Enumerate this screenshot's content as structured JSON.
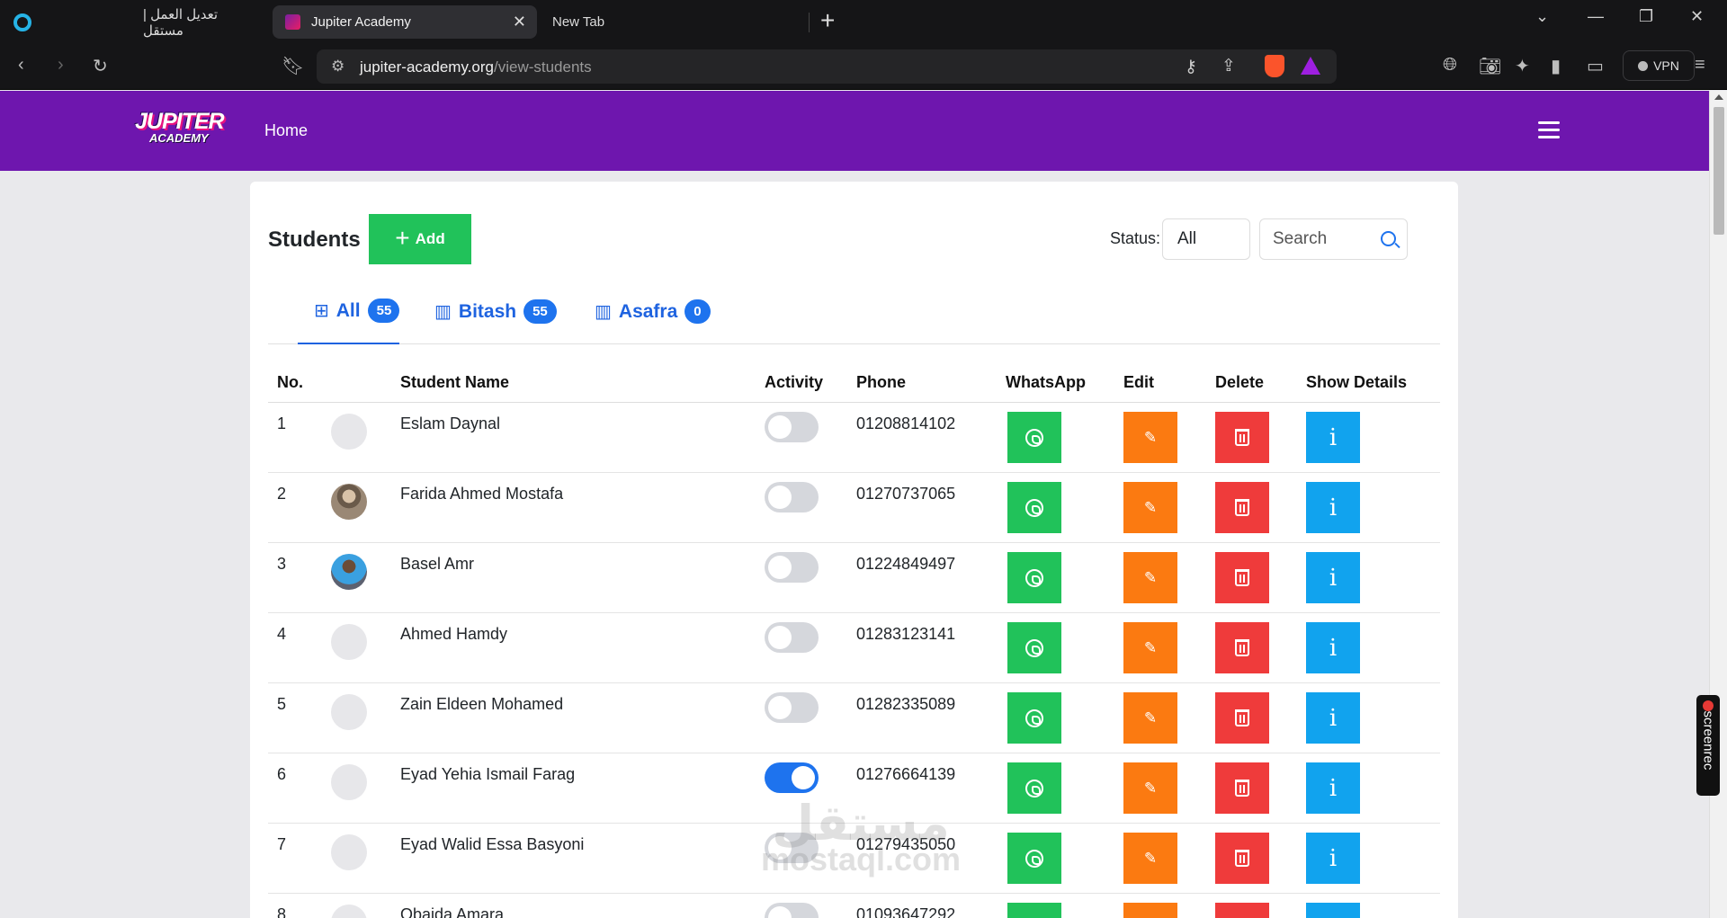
{
  "browser": {
    "tabs": [
      {
        "title": "تعديل العمل | مستقل"
      },
      {
        "title": "Jupiter Academy"
      },
      {
        "title": "New Tab"
      }
    ],
    "url_domain": "jupiter-academy.org",
    "url_path": "/view-students",
    "vpn_label": "VPN"
  },
  "nav": {
    "brand_line1": "JUPITER",
    "brand_line2": "ACADEMY",
    "home_label": "Home"
  },
  "page": {
    "title": "Students",
    "add_label": "Add",
    "status_label": "Status:",
    "status_value": "All",
    "search_placeholder": "Search"
  },
  "category_tabs": [
    {
      "label": "All",
      "count": "55",
      "icon": "grid-icon"
    },
    {
      "label": "Bitash",
      "count": "55",
      "icon": "building-icon"
    },
    {
      "label": "Asafra",
      "count": "0",
      "icon": "building-icon"
    }
  ],
  "table": {
    "headers": {
      "no": "No.",
      "name": "Student Name",
      "activity": "Activity",
      "phone": "Phone",
      "whatsapp": "WhatsApp",
      "edit": "Edit",
      "delete": "Delete",
      "details": "Show Details"
    },
    "rows": [
      {
        "no": "1",
        "name": "Eslam Daynal",
        "phone": "01208814102",
        "active": false,
        "avatar": "placeholder"
      },
      {
        "no": "2",
        "name": "Farida Ahmed Mostafa",
        "phone": "01270737065",
        "active": false,
        "avatar": "photo1"
      },
      {
        "no": "3",
        "name": "Basel Amr",
        "phone": "01224849497",
        "active": false,
        "avatar": "photo2"
      },
      {
        "no": "4",
        "name": "Ahmed Hamdy",
        "phone": "01283123141",
        "active": false,
        "avatar": "placeholder"
      },
      {
        "no": "5",
        "name": "Zain Eldeen Mohamed",
        "phone": "01282335089",
        "active": false,
        "avatar": "placeholder"
      },
      {
        "no": "6",
        "name": "Eyad Yehia Ismail Farag",
        "phone": "01276664139",
        "active": true,
        "avatar": "placeholder"
      },
      {
        "no": "7",
        "name": "Eyad Walid Essa Basyoni",
        "phone": "01279435050",
        "active": false,
        "avatar": "placeholder"
      },
      {
        "no": "8",
        "name": "Obaida Amara",
        "phone": "01093647292",
        "active": false,
        "avatar": "placeholder"
      }
    ]
  },
  "watermark": {
    "line1": "مستقل",
    "line2": "mostaql.com"
  },
  "screenrec_label": "screenrec",
  "colors": {
    "navbar": "#6e16ae",
    "add": "#21c25a",
    "whatsapp": "#21c25a",
    "edit": "#fb7a11",
    "delete": "#ef3b3b",
    "info": "#11a3ee",
    "primary": "#1e63e0"
  }
}
